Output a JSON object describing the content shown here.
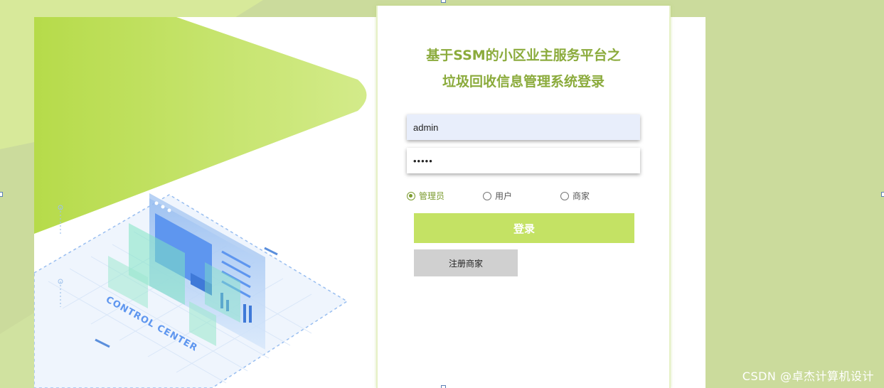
{
  "login": {
    "title_line1": "基于SSM的小区业主服务平台之",
    "title_line2": "垃圾回收信息管理系统登录",
    "username_value": "admin",
    "password_value": "•••••",
    "roles": [
      {
        "label": "管理员",
        "selected": true
      },
      {
        "label": "用户",
        "selected": false
      },
      {
        "label": "商家",
        "selected": false
      }
    ],
    "login_button": "登录",
    "register_button": "注册商家"
  },
  "illustration": {
    "caption": "CONTROL CENTER"
  },
  "watermark": "CSDN @卓杰计算机设计",
  "colors": {
    "background": "#cbdb9c",
    "accent": "#c4e264",
    "title": "#8bab3c",
    "radio_selected": "#7b9b2f",
    "secondary_button": "#d0d0d0"
  }
}
